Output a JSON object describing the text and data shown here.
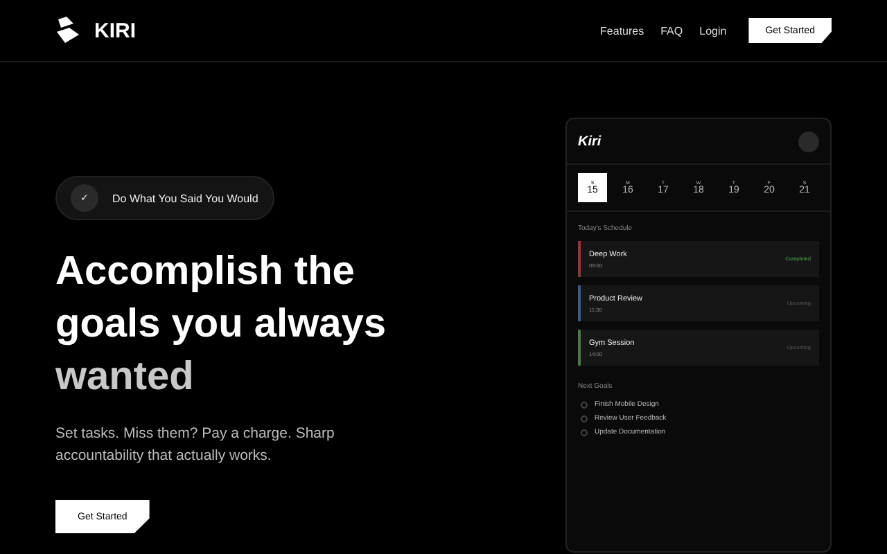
{
  "brand": "KIRI",
  "nav": {
    "links": [
      "Features",
      "FAQ",
      "Login"
    ],
    "cta": "Get Started"
  },
  "hero": {
    "badge_icon": "✓",
    "badge": "Do What You Said You Would",
    "headline": [
      {
        "text": "Accomplish the",
        "muted": false
      },
      {
        "text": "goals you always",
        "muted": false
      },
      {
        "text": "wanted",
        "muted": true
      }
    ],
    "subtitle": "Set tasks. Miss them? Pay a charge. Sharp accountability that actually works.",
    "cta": "Get Started"
  },
  "app": {
    "title": "Kiri",
    "days": [
      {
        "letter": "S",
        "date": "15",
        "selected": true
      },
      {
        "letter": "M",
        "date": "16",
        "selected": false
      },
      {
        "letter": "T",
        "date": "17",
        "selected": false
      },
      {
        "letter": "W",
        "date": "18",
        "selected": false
      },
      {
        "letter": "T",
        "date": "19",
        "selected": false
      },
      {
        "letter": "F",
        "date": "20",
        "selected": false
      },
      {
        "letter": "S",
        "date": "21",
        "selected": false
      }
    ],
    "schedule_title": "Today's Schedule",
    "schedule": [
      {
        "name": "Deep Work",
        "time": "09:00",
        "status": "Completed",
        "completed": true,
        "color": "#8a3a3a"
      },
      {
        "name": "Product Review",
        "time": "11:30",
        "status": "Upcoming",
        "completed": false,
        "color": "#3a5a8a"
      },
      {
        "name": "Gym Session",
        "time": "14:00",
        "status": "Upcoming",
        "completed": false,
        "color": "#4a7a4a"
      }
    ],
    "goals_title": "Next Goals",
    "goals": [
      "Finish Mobile Design",
      "Review User Feedback",
      "Update Documentation"
    ]
  }
}
